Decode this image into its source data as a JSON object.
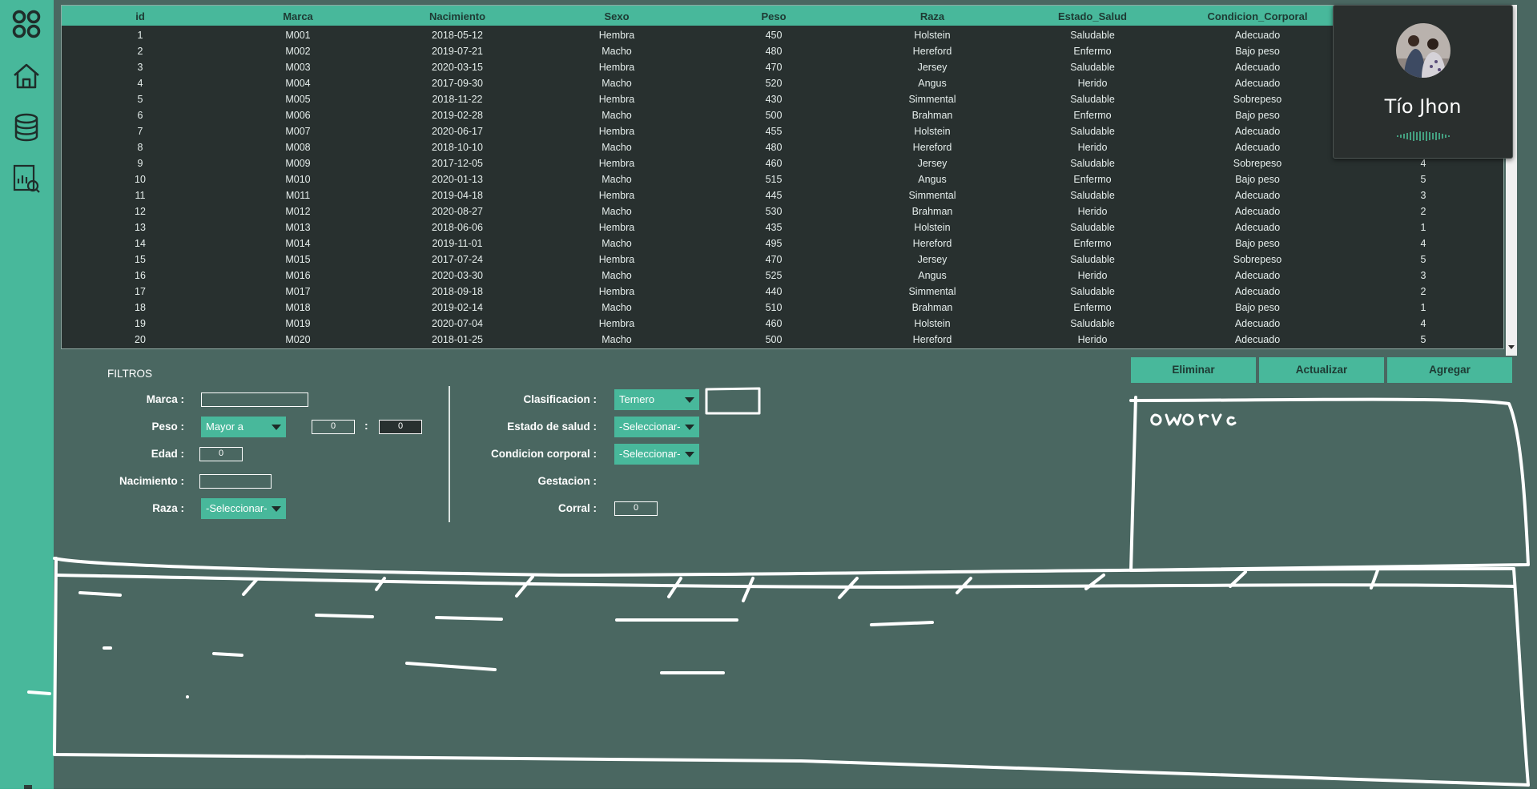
{
  "sidebar": {
    "items": [
      {
        "icon": "grid-icon"
      },
      {
        "icon": "home-icon"
      },
      {
        "icon": "database-icon"
      },
      {
        "icon": "report-icon"
      }
    ]
  },
  "table": {
    "columns": [
      "id",
      "Marca",
      "Nacimiento",
      "Sexo",
      "Peso",
      "Raza",
      "Estado_Salud",
      "Condicion_Corporal",
      ""
    ],
    "rows": [
      [
        "1",
        "M001",
        "2018-05-12",
        "Hembra",
        "450",
        "Holstein",
        "Saludable",
        "Adecuado",
        ""
      ],
      [
        "2",
        "M002",
        "2019-07-21",
        "Macho",
        "480",
        "Hereford",
        "Enfermo",
        "Bajo peso",
        ""
      ],
      [
        "3",
        "M003",
        "2020-03-15",
        "Hembra",
        "470",
        "Jersey",
        "Saludable",
        "Adecuado",
        ""
      ],
      [
        "4",
        "M004",
        "2017-09-30",
        "Macho",
        "520",
        "Angus",
        "Herido",
        "Adecuado",
        ""
      ],
      [
        "5",
        "M005",
        "2018-11-22",
        "Hembra",
        "430",
        "Simmental",
        "Saludable",
        "Sobrepeso",
        ""
      ],
      [
        "6",
        "M006",
        "2019-02-28",
        "Macho",
        "500",
        "Brahman",
        "Enfermo",
        "Bajo peso",
        ""
      ],
      [
        "7",
        "M007",
        "2020-06-17",
        "Hembra",
        "455",
        "Holstein",
        "Saludable",
        "Adecuado",
        ""
      ],
      [
        "8",
        "M008",
        "2018-10-10",
        "Macho",
        "480",
        "Hereford",
        "Herido",
        "Adecuado",
        ""
      ],
      [
        "9",
        "M009",
        "2017-12-05",
        "Hembra",
        "460",
        "Jersey",
        "Saludable",
        "Sobrepeso",
        "4"
      ],
      [
        "10",
        "M010",
        "2020-01-13",
        "Macho",
        "515",
        "Angus",
        "Enfermo",
        "Bajo peso",
        "5"
      ],
      [
        "11",
        "M011",
        "2019-04-18",
        "Hembra",
        "445",
        "Simmental",
        "Saludable",
        "Adecuado",
        "3"
      ],
      [
        "12",
        "M012",
        "2020-08-27",
        "Macho",
        "530",
        "Brahman",
        "Herido",
        "Adecuado",
        "2"
      ],
      [
        "13",
        "M013",
        "2018-06-06",
        "Hembra",
        "435",
        "Holstein",
        "Saludable",
        "Adecuado",
        "1"
      ],
      [
        "14",
        "M014",
        "2019-11-01",
        "Macho",
        "495",
        "Hereford",
        "Enfermo",
        "Bajo peso",
        "4"
      ],
      [
        "15",
        "M015",
        "2017-07-24",
        "Hembra",
        "470",
        "Jersey",
        "Saludable",
        "Sobrepeso",
        "5"
      ],
      [
        "16",
        "M016",
        "2020-03-30",
        "Macho",
        "525",
        "Angus",
        "Herido",
        "Adecuado",
        "3"
      ],
      [
        "17",
        "M017",
        "2018-09-18",
        "Hembra",
        "440",
        "Simmental",
        "Saludable",
        "Adecuado",
        "2"
      ],
      [
        "18",
        "M018",
        "2019-02-14",
        "Macho",
        "510",
        "Brahman",
        "Enfermo",
        "Bajo peso",
        "1"
      ],
      [
        "19",
        "M019",
        "2020-07-04",
        "Hembra",
        "460",
        "Holstein",
        "Saludable",
        "Adecuado",
        "4"
      ],
      [
        "20",
        "M020",
        "2018-01-25",
        "Macho",
        "500",
        "Hereford",
        "Herido",
        "Adecuado",
        "5"
      ]
    ]
  },
  "filters": {
    "title": "FILTROS",
    "marca_label": "Marca :",
    "marca_value": "",
    "peso_label": "Peso :",
    "peso_select": "Mayor a",
    "peso_min": "0",
    "peso_sep": ":",
    "peso_max": "0",
    "edad_label": "Edad :",
    "edad_value": "0",
    "nacimiento_label": "Nacimiento :",
    "nacimiento_value": "",
    "raza_label": "Raza :",
    "raza_select": "-Seleccionar-",
    "clasificacion_label": "Clasificacion :",
    "clasificacion_select": "Ternero",
    "estado_label": "Estado de salud :",
    "estado_select": "-Seleccionar-",
    "condicion_label": "Condicion corporal :",
    "condicion_select": "-Seleccionar-",
    "gestacion_label": "Gestacion :",
    "corral_label": "Corral :",
    "corral_value": "0"
  },
  "actions": {
    "eliminar": "Eliminar",
    "actualizar": "Actualizar",
    "agregar": "Agregar"
  },
  "call": {
    "name": "Tío Jhon"
  },
  "colors": {
    "accent": "#48b89b",
    "background": "#4a6761",
    "table_bg": "#28302f"
  }
}
